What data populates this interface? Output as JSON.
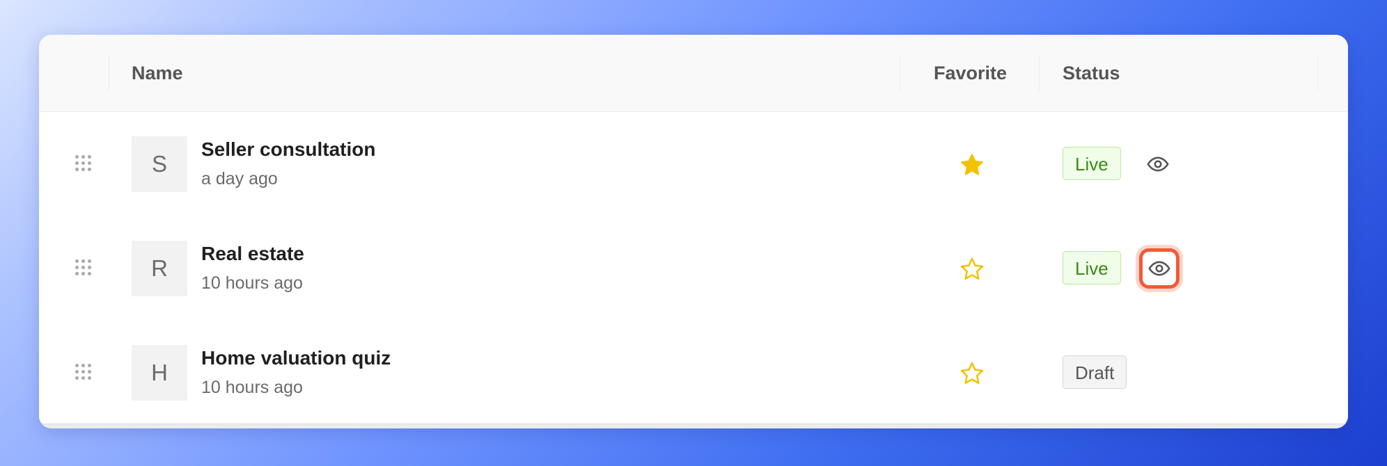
{
  "table": {
    "columns": {
      "name": "Name",
      "favorite": "Favorite",
      "status": "Status"
    },
    "rows": [
      {
        "initial": "S",
        "title": "Seller consultation",
        "time": "a day ago",
        "favorite": true,
        "status": "Live",
        "preview_icon": "eye-icon",
        "preview_highlighted": false
      },
      {
        "initial": "R",
        "title": "Real estate",
        "time": "10 hours ago",
        "favorite": false,
        "status": "Live",
        "preview_icon": "eye-icon",
        "preview_highlighted": true
      },
      {
        "initial": "H",
        "title": "Home valuation quiz",
        "time": "10 hours ago",
        "favorite": false,
        "status": "Draft"
      }
    ]
  },
  "colors": {
    "star": "#f2c200",
    "live_badge_bg": "#f0fde8",
    "live_badge_text": "#3a8a16",
    "draft_badge_text": "#555555",
    "highlight": "#f25a36"
  }
}
